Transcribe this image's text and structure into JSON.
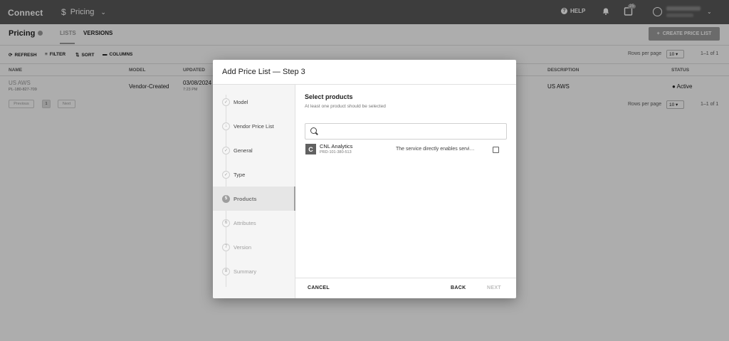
{
  "app": {
    "brand": "Connect",
    "module_label": "Pricing",
    "help_label": "HELP",
    "notifications_badge": "25"
  },
  "page": {
    "title": "Pricing",
    "tabs": [
      {
        "label": "LISTS"
      },
      {
        "label": "VERSIONS"
      }
    ],
    "create_button": "CREATE PRICE LIST"
  },
  "toolbar": {
    "refresh": "REFRESH",
    "filter": "FILTER",
    "sort": "SORT",
    "columns": "COLUMNS",
    "rows_per_page_label": "Rows per page",
    "rows_per_page_value": "10",
    "range": "1–1 of 1"
  },
  "table": {
    "headers": {
      "name": "NAME",
      "model": "MODEL",
      "updated": "UPDATED",
      "description": "DESCRIPTION",
      "status": "STATUS"
    },
    "row": {
      "name": "US AWS",
      "id": "PL-180-827-709",
      "model": "Vendor-Created",
      "updated_date": "03/08/2024",
      "updated_time": "7:23 PM",
      "description": "US AWS",
      "status": "Active"
    },
    "pager": {
      "previous": "Previous",
      "page": "1",
      "next": "Next"
    }
  },
  "dialog": {
    "title": "Add Price List — Step 3",
    "steps": [
      {
        "label": "Model",
        "marker": "✓"
      },
      {
        "label": "Vendor Price List",
        "marker": "↓"
      },
      {
        "label": "General",
        "marker": "✓"
      },
      {
        "label": "Type",
        "marker": "✓"
      },
      {
        "label": "Products",
        "marker": "5"
      },
      {
        "label": "Attributes",
        "marker": "6"
      },
      {
        "label": "Version",
        "marker": "7"
      },
      {
        "label": "Summary",
        "marker": "8"
      }
    ],
    "active_step": 4,
    "content": {
      "heading": "Select products",
      "subheading": "At least one product should be selected",
      "search_value": "",
      "products": [
        {
          "logo_letter": "C",
          "name": "CNL Analytics",
          "id": "PRD-101-380-513",
          "description": "The service directly enables servi…",
          "selected": false
        }
      ]
    },
    "footer": {
      "cancel": "CANCEL",
      "back": "BACK",
      "next": "NEXT"
    }
  },
  "colors": {
    "topbar": "#5b5b5b",
    "accent_gray": "#9e9e9e",
    "overlay": "rgba(0,0,0,0.32)"
  }
}
